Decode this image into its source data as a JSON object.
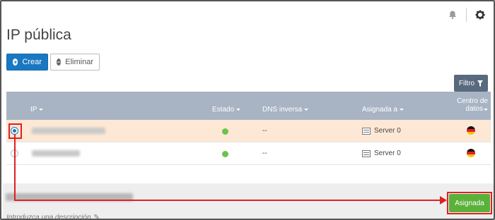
{
  "page": {
    "title": "IP pública"
  },
  "topbar": {
    "bell_icon": "bell-icon",
    "gear_icon": "gear-icon"
  },
  "toolbar": {
    "create_label": "Crear",
    "delete_label": "Eliminar"
  },
  "filter": {
    "label": "Filtro",
    "icon": "filter-icon"
  },
  "table": {
    "columns": {
      "ip": "IP",
      "estado": "Estado",
      "dns": "DNS inversa",
      "asignada": "Asignada a",
      "centro_line1": "Centro de",
      "centro_line2": "datos"
    },
    "rows": [
      {
        "ip": "",
        "status": "active",
        "dns": "--",
        "assigned": "Server 0",
        "datacenter_flag": "germany-flag-icon",
        "selected": true
      },
      {
        "ip": "",
        "status": "active",
        "dns": "--",
        "assigned": "Server 0",
        "datacenter_flag": "germany-flag-icon",
        "selected": false
      }
    ]
  },
  "detail": {
    "description_placeholder": "Introduzca una descripción",
    "assigned_button": "Asignada"
  },
  "colors": {
    "primary": "#1a78c2",
    "success": "#5ab13a",
    "status_green": "#6cc24a",
    "header_bg": "#a8b4c4",
    "selected_row": "#fce8d5",
    "annotation_red": "#e02020"
  }
}
